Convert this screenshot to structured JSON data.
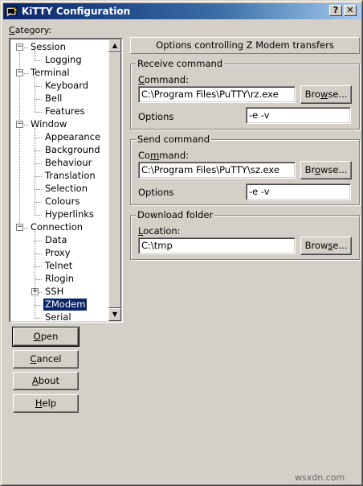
{
  "window": {
    "title": "KiTTY Configuration",
    "help_btn": "?",
    "close_btn": "✕"
  },
  "category_label": "Category:",
  "tree": [
    {
      "label": "Session",
      "level": 0,
      "expander": "minus"
    },
    {
      "label": "Logging",
      "level": 1
    },
    {
      "label": "Terminal",
      "level": 0,
      "expander": "minus"
    },
    {
      "label": "Keyboard",
      "level": 1
    },
    {
      "label": "Bell",
      "level": 1
    },
    {
      "label": "Features",
      "level": 1
    },
    {
      "label": "Window",
      "level": 0,
      "expander": "minus"
    },
    {
      "label": "Appearance",
      "level": 1
    },
    {
      "label": "Background",
      "level": 1
    },
    {
      "label": "Behaviour",
      "level": 1
    },
    {
      "label": "Translation",
      "level": 1
    },
    {
      "label": "Selection",
      "level": 1
    },
    {
      "label": "Colours",
      "level": 1
    },
    {
      "label": "Hyperlinks",
      "level": 1
    },
    {
      "label": "Connection",
      "level": 0,
      "expander": "minus"
    },
    {
      "label": "Data",
      "level": 1
    },
    {
      "label": "Proxy",
      "level": 1
    },
    {
      "label": "Telnet",
      "level": 1
    },
    {
      "label": "Rlogin",
      "level": 1
    },
    {
      "label": "SSH",
      "level": 1,
      "expander": "plus"
    },
    {
      "label": "ZModem",
      "level": 1,
      "selected": true
    },
    {
      "label": "Serial",
      "level": 1
    }
  ],
  "buttons": {
    "open": "Open",
    "cancel": "Cancel",
    "about": "About",
    "help": "Help"
  },
  "panel": {
    "heading": "Options controlling Z Modem transfers",
    "receive": {
      "title": "Receive command",
      "command_label": "Command:",
      "command_value": "C:\\Program Files\\PuTTY\\rz.exe",
      "browse": "Browse...",
      "options_label": "Options",
      "options_value": "-e -v"
    },
    "send": {
      "title": "Send command",
      "command_label": "Command:",
      "command_value": "C:\\Program Files\\PuTTY\\sz.exe",
      "browse": "Browse...",
      "options_label": "Options",
      "options_value": "-e -v"
    },
    "download": {
      "title": "Download folder",
      "location_label": "Location:",
      "location_value": "C:\\tmp",
      "browse": "Browse..."
    }
  },
  "watermark": "wsxdn.com",
  "colors": {
    "titlebar_start": "#0a246a",
    "titlebar_end": "#a6caf0",
    "dialog_face": "#d4d0c8",
    "selection": "#0a246a"
  }
}
